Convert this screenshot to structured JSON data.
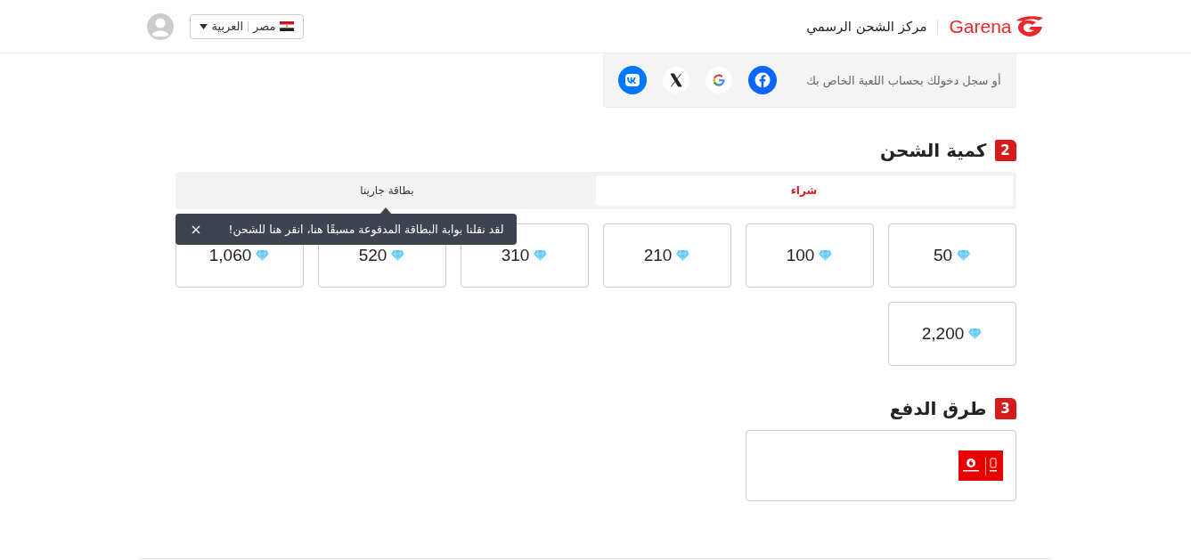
{
  "header": {
    "brand": "Garena",
    "title": "مركز الشحن الرسمي",
    "country": "مصر",
    "language": "العربية"
  },
  "login": {
    "text": "أو سجل دخولك بحساب اللعبة الخاص بك",
    "providers": [
      {
        "kind": "facebook"
      },
      {
        "kind": "google"
      },
      {
        "kind": "x"
      },
      {
        "kind": "vk"
      }
    ]
  },
  "amount_section": {
    "number": "2",
    "title": "كمية الشحن",
    "tabs": [
      {
        "label": "شراء",
        "selected": true
      },
      {
        "label": "بطاقة جارينا",
        "selected": false
      }
    ],
    "tooltip": {
      "text": "لقد نقلنا بوابة البطاقة المدفوعة مسبقًا هنا، انقر هنا للشحن!"
    },
    "packages": [
      {
        "amount": "50"
      },
      {
        "amount": "100"
      },
      {
        "amount": "210"
      },
      {
        "amount": "310"
      },
      {
        "amount": "520"
      },
      {
        "amount": "1,060"
      },
      {
        "amount": "2,200"
      }
    ]
  },
  "payment_section": {
    "number": "3",
    "title": "طرق الدفع",
    "methods": [
      {
        "kind": "vodafone-cash"
      }
    ]
  }
}
